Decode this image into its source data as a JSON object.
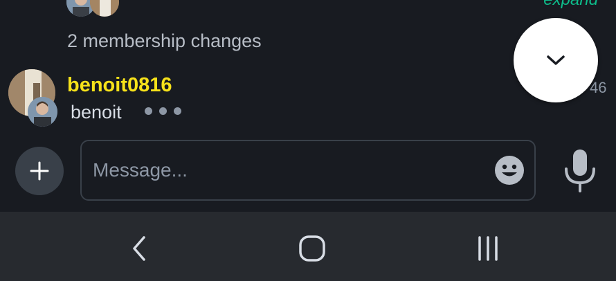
{
  "timeline": {
    "expand_label": "expand",
    "membership_changes": "2 membership changes",
    "sender_name": "benoit0816",
    "timestamp": "46",
    "typing_user": "benoit"
  },
  "composer": {
    "placeholder": "Message..."
  },
  "icons": {
    "scroll_down": "chevron-down-icon",
    "add": "plus-icon",
    "emoji": "emoji-icon",
    "mic": "microphone-icon",
    "back": "back-icon",
    "home": "home-icon",
    "recents": "recents-icon"
  },
  "colors": {
    "background": "#181b21",
    "accent": "#0dbd8b",
    "username": "#f7e21a",
    "navbar": "#272a2f"
  }
}
